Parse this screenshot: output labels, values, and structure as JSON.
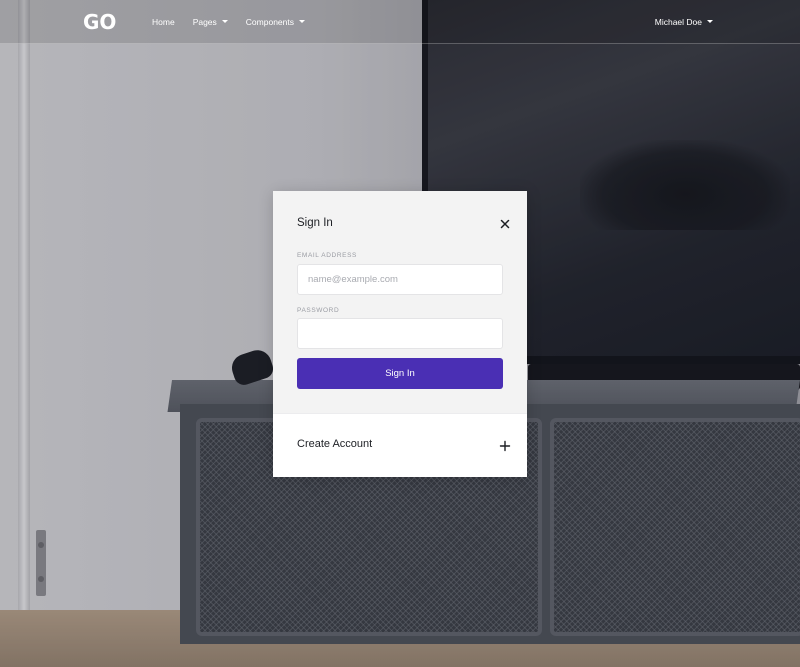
{
  "navbar": {
    "logo_text": "GO",
    "links": [
      {
        "label": "Home",
        "has_caret": false
      },
      {
        "label": "Pages",
        "has_caret": true
      },
      {
        "label": "Components",
        "has_caret": true
      }
    ],
    "user_name": "Michael Doe"
  },
  "modal": {
    "title": "Sign In",
    "close_icon": "close-icon",
    "email": {
      "label": "EMAIL ADDRESS",
      "placeholder": "name@example.com",
      "value": ""
    },
    "password": {
      "label": "PASSWORD",
      "placeholder": "",
      "value": ""
    },
    "submit_label": "Sign In",
    "footer": {
      "label": "Create Account",
      "icon": "plus-icon"
    }
  },
  "colors": {
    "primary": "#4a2fb4",
    "modal_bg": "#f3f3f3",
    "footer_bg": "#ffffff",
    "text_dark": "#1d1f24",
    "label_gray": "#9a9ca3"
  }
}
